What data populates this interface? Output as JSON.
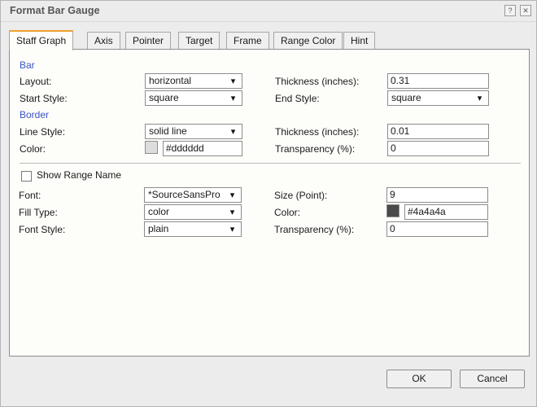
{
  "window": {
    "title": "Format Bar Gauge",
    "help_icon": "help-icon",
    "help_glyph": "?",
    "close_icon": "close-icon",
    "close_glyph": "✕"
  },
  "tabs": [
    {
      "label": "Staff Graph",
      "active": true
    },
    {
      "label": "Axis",
      "active": false
    },
    {
      "label": "Pointer",
      "active": false
    },
    {
      "label": "Target",
      "active": false
    },
    {
      "label": "Frame",
      "active": false
    },
    {
      "label": "Range Color",
      "active": false
    },
    {
      "label": "Hint",
      "active": false
    }
  ],
  "sections": {
    "bar": {
      "heading": "Bar",
      "layout_label": "Layout:",
      "layout_value": "horizontal",
      "thickness_label": "Thickness (inches):",
      "thickness_value": "0.31",
      "start_style_label": "Start Style:",
      "start_style_value": "square",
      "end_style_label": "End Style:",
      "end_style_value": "square"
    },
    "border": {
      "heading": "Border",
      "line_style_label": "Line Style:",
      "line_style_value": "solid line",
      "thickness_label": "Thickness (inches):",
      "thickness_value": "0.01",
      "color_label": "Color:",
      "color_value": "#dddddd",
      "color_swatch": "#dddddd",
      "transparency_label": "Transparency (%):",
      "transparency_value": "0"
    },
    "range_name": {
      "checkbox_label": "Show Range Name",
      "checked": false,
      "font_label": "Font:",
      "font_value": "*SourceSansPro",
      "size_label": "Size (Point):",
      "size_value": "9",
      "fill_type_label": "Fill Type:",
      "fill_type_value": "color",
      "color_label": "Color:",
      "color_value": "#4a4a4a",
      "color_swatch": "#4a4a4a",
      "font_style_label": "Font Style:",
      "font_style_value": "plain",
      "transparency_label": "Transparency (%):",
      "transparency_value": "0"
    }
  },
  "footer": {
    "ok_label": "OK",
    "cancel_label": "Cancel"
  },
  "colors": {
    "accent": "#f0a030",
    "section_heading": "#3b53c8",
    "dialog_bg": "#ececec",
    "panel_bg": "#fdfdfa"
  }
}
